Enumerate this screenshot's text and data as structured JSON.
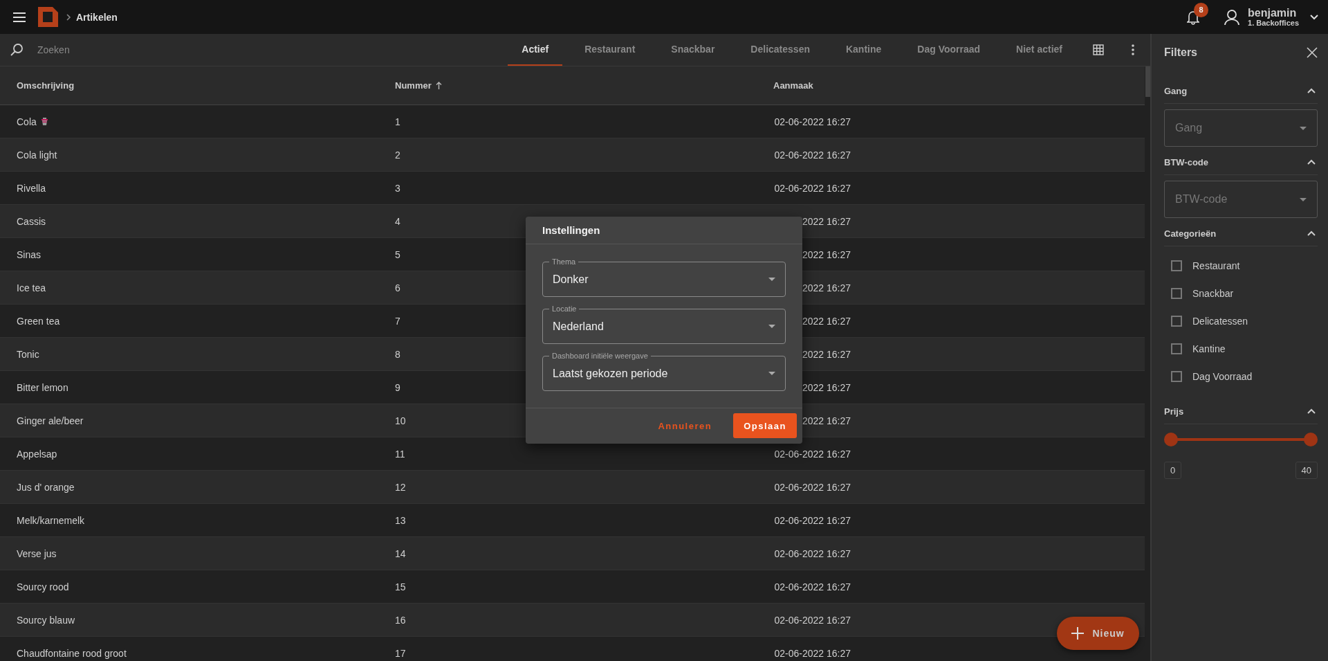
{
  "header": {
    "breadcrumb": "Artikelen",
    "notifications": "8",
    "user": {
      "name": "benjamin",
      "role": "1. Backoffices"
    }
  },
  "search": {
    "placeholder": "Zoeken"
  },
  "tabs": [
    {
      "label": "Actief",
      "selected": true
    },
    {
      "label": "Restaurant",
      "selected": false
    },
    {
      "label": "Snackbar",
      "selected": false
    },
    {
      "label": "Delicatessen",
      "selected": false
    },
    {
      "label": "Kantine",
      "selected": false
    },
    {
      "label": "Dag Voorraad",
      "selected": false
    },
    {
      "label": "Niet actief",
      "selected": false
    }
  ],
  "table": {
    "columns": [
      {
        "label": "Omschrijving",
        "sorted": false
      },
      {
        "label": "Nummer",
        "sorted": true
      },
      {
        "label": "Aanmaak",
        "sorted": false
      }
    ],
    "rows": [
      {
        "cells": [
          "Cola",
          "1",
          "02-06-2022 16:27"
        ],
        "flagged": true
      },
      {
        "cells": [
          "Cola light",
          "2",
          "02-06-2022 16:27"
        ],
        "flagged": false
      },
      {
        "cells": [
          "Rivella",
          "3",
          "02-06-2022 16:27"
        ],
        "flagged": false
      },
      {
        "cells": [
          "Cassis",
          "4",
          "2022 16:27"
        ],
        "flagged": false
      },
      {
        "cells": [
          "Sinas",
          "5",
          "2022 16:27"
        ],
        "flagged": false
      },
      {
        "cells": [
          "Ice tea",
          "6",
          "2022 16:27"
        ],
        "flagged": false
      },
      {
        "cells": [
          "Green tea",
          "7",
          "2022 16:27"
        ],
        "flagged": false
      },
      {
        "cells": [
          "Tonic",
          "8",
          "2022 16:27"
        ],
        "flagged": false
      },
      {
        "cells": [
          "Bitter lemon",
          "9",
          "2022 16:27"
        ],
        "flagged": false
      },
      {
        "cells": [
          "Ginger ale/beer",
          "10",
          "2022 16:27"
        ],
        "flagged": false
      },
      {
        "cells": [
          "Appelsap",
          "11",
          "02-06-2022 16:27"
        ],
        "flagged": false
      },
      {
        "cells": [
          "Jus d' orange",
          "12",
          "02-06-2022 16:27"
        ],
        "flagged": false
      },
      {
        "cells": [
          "Melk/karnemelk",
          "13",
          "02-06-2022 16:27"
        ],
        "flagged": false
      },
      {
        "cells": [
          "Verse jus",
          "14",
          "02-06-2022 16:27"
        ],
        "flagged": false
      },
      {
        "cells": [
          "Sourcy rood",
          "15",
          "02-06-2022 16:27"
        ],
        "flagged": false
      },
      {
        "cells": [
          "Sourcy blauw",
          "16",
          "02-06-2022 16:27"
        ],
        "flagged": false
      },
      {
        "cells": [
          "Chaudfontaine rood groot",
          "17",
          "02-06-2022 16:27"
        ],
        "flagged": false
      }
    ]
  },
  "dialog": {
    "title": "Instellingen",
    "fields": [
      {
        "label": "Thema",
        "value": "Donker"
      },
      {
        "label": "Locatie",
        "value": "Nederland"
      },
      {
        "label": "Dashboard initiële weergave",
        "value": "Laatst gekozen periode"
      }
    ],
    "buttons": [
      {
        "label": "Annuleren",
        "kind": "text"
      },
      {
        "label": "Opslaan",
        "kind": "primary"
      }
    ]
  },
  "fab": {
    "label": "Nieuw"
  },
  "filters": {
    "title": "Filters",
    "sections": [
      {
        "title": "Gang",
        "expanded": true,
        "kind": "select",
        "placeholder": "Gang"
      },
      {
        "title": "BTW-code",
        "expanded": true,
        "kind": "select",
        "placeholder": "BTW-code"
      },
      {
        "title": "Categorieën",
        "expanded": true,
        "kind": "checklist",
        "options": [
          {
            "label": "Restaurant",
            "checked": false
          },
          {
            "label": "Snackbar",
            "checked": false
          },
          {
            "label": "Delicatessen",
            "checked": false
          },
          {
            "label": "Kantine",
            "checked": false
          },
          {
            "label": "Dag Voorraad",
            "checked": false
          }
        ]
      },
      {
        "title": "Prijs",
        "expanded": true,
        "kind": "range",
        "low": {
          "level": 0,
          "reading": "0"
        },
        "high": {
          "level": 1,
          "reading": "40"
        }
      }
    ]
  }
}
